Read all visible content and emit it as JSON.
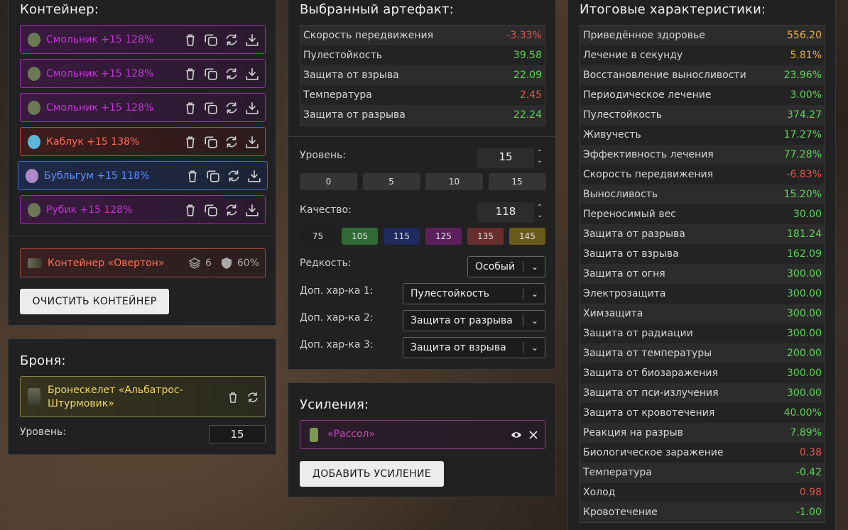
{
  "container": {
    "title": "Контейнер:",
    "items": [
      {
        "name": "Смольник +15 128%",
        "style": "purple"
      },
      {
        "name": "Смольник +15 128%",
        "style": "purple"
      },
      {
        "name": "Смольник +15 128%",
        "style": "purple"
      },
      {
        "name": "Каблук +15 138%",
        "style": "red"
      },
      {
        "name": "Бубльгум +15 118%",
        "style": "blue"
      },
      {
        "name": "Рубик +15 128%",
        "style": "purple"
      }
    ],
    "card": {
      "name": "Контейнер «Овертон»",
      "slots": "6",
      "protection": "60%"
    },
    "clear_button": "ОЧИСТИТЬ КОНТЕЙНЕР"
  },
  "armor": {
    "title": "Броня:",
    "name": "Бронескелет «Альбатрос-Штурмовик»",
    "level_label": "Уровень:",
    "level_value": "15"
  },
  "artifact": {
    "title": "Выбранный артефакт:",
    "stats": [
      {
        "label": "Скорость передвижения",
        "value": "-3.33%",
        "tone": "neg"
      },
      {
        "label": "Пулестойкость",
        "value": "39.58",
        "tone": "pos"
      },
      {
        "label": "Защита от взрыва",
        "value": "22.09",
        "tone": "pos"
      },
      {
        "label": "Температура",
        "value": "2.45",
        "tone": "neg"
      },
      {
        "label": "Защита от разрыва",
        "value": "22.24",
        "tone": "pos"
      }
    ],
    "level_label": "Уровень:",
    "level_value": "15",
    "level_presets": [
      "0",
      "5",
      "10",
      "15"
    ],
    "quality_label": "Качество:",
    "quality_value": "118",
    "quality_presets": [
      {
        "label": "75",
        "color": "#1f1f1f"
      },
      {
        "label": "105",
        "color": "#2f6a35"
      },
      {
        "label": "115",
        "color": "#1f2a5e"
      },
      {
        "label": "125",
        "color": "#5a1f5c"
      },
      {
        "label": "135",
        "color": "#6a2d2d"
      },
      {
        "label": "145",
        "color": "#6a5a1a"
      }
    ],
    "rarity_label": "Редкость:",
    "rarity_value": "Особый",
    "extra1_label": "Доп. хар-ка 1:",
    "extra1_value": "Пулестойкость",
    "extra2_label": "Доп. хар-ка 2:",
    "extra2_value": "Защита от разрыва",
    "extra3_label": "Доп. хар-ка 3:",
    "extra3_value": "Защита от взрыва"
  },
  "boosts": {
    "title": "Усиления:",
    "item": "«Рассол»",
    "add_button": "ДОБАВИТЬ УСИЛЕНИЕ"
  },
  "totals": {
    "title": "Итоговые характеристики:",
    "stats": [
      {
        "label": "Приведённое здоровье",
        "value": "556.20",
        "tone": "gold"
      },
      {
        "label": "Лечение в секунду",
        "value": "5.81%",
        "tone": "gold"
      },
      {
        "label": "Восстановление выносливости",
        "value": "23.96%",
        "tone": "pos"
      },
      {
        "label": "Периодическое лечение",
        "value": "3.00%",
        "tone": "pos"
      },
      {
        "label": "Пулестойкость",
        "value": "374.27",
        "tone": "pos"
      },
      {
        "label": "Живучесть",
        "value": "17.27%",
        "tone": "pos"
      },
      {
        "label": "Эффективность лечения",
        "value": "77.28%",
        "tone": "pos"
      },
      {
        "label": "Скорость передвижения",
        "value": "-6.83%",
        "tone": "neg"
      },
      {
        "label": "Выносливость",
        "value": "15.20%",
        "tone": "pos"
      },
      {
        "label": "Переносимый вес",
        "value": "30.00",
        "tone": "pos"
      },
      {
        "label": "Защита от разрыва",
        "value": "181.24",
        "tone": "pos"
      },
      {
        "label": "Защита от взрыва",
        "value": "162.09",
        "tone": "pos"
      },
      {
        "label": "Защита от огня",
        "value": "300.00",
        "tone": "pos"
      },
      {
        "label": "Электрозащита",
        "value": "300.00",
        "tone": "pos"
      },
      {
        "label": "Химзащита",
        "value": "300.00",
        "tone": "pos"
      },
      {
        "label": "Защита от радиации",
        "value": "300.00",
        "tone": "pos"
      },
      {
        "label": "Защита от температуры",
        "value": "200.00",
        "tone": "pos"
      },
      {
        "label": "Защита от биозаражения",
        "value": "300.00",
        "tone": "pos"
      },
      {
        "label": "Защита от пси-излучения",
        "value": "300.00",
        "tone": "pos"
      },
      {
        "label": "Защита от кровотечения",
        "value": "40.00%",
        "tone": "pos"
      },
      {
        "label": "Реакция на разрыв",
        "value": "7.89%",
        "tone": "pos"
      },
      {
        "label": "Биологическое заражение",
        "value": "0.38",
        "tone": "neg"
      },
      {
        "label": "Температура",
        "value": "-0.42",
        "tone": "pos"
      },
      {
        "label": "Холод",
        "value": "0.98",
        "tone": "neg"
      },
      {
        "label": "Кровотечение",
        "value": "-1.00",
        "tone": "pos"
      }
    ]
  }
}
